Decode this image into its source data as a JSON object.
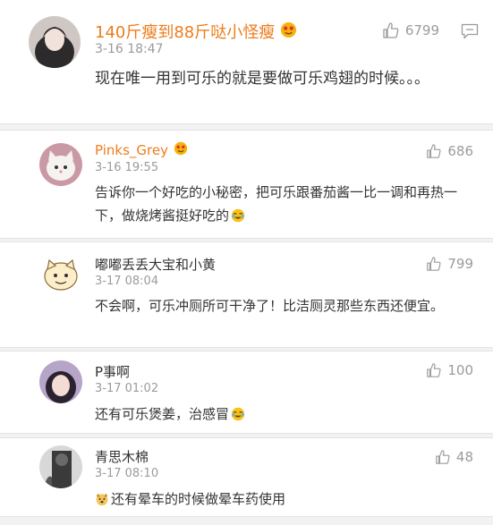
{
  "comments": [
    {
      "name": "140斤瘦到88斤哒小怪瘦",
      "time": "3-16 18:47",
      "text": "现在唯一用到可乐的就是要做可乐鸡翅的时候。。。",
      "likes": "6799",
      "badge": "vip-face-icon",
      "name_color": "#ec7d1c"
    },
    {
      "name": "Pinks_Grey",
      "time": "3-16 19:55",
      "text": "告诉你一个好吃的小秘密，把可乐跟番茄酱一比一调和再热一下，做烧烤酱挺好吃的",
      "likes": "686",
      "badge": "vip-face-icon",
      "name_color": "#ec7d1c",
      "trailing_emoji": "laugh-cry-emoji"
    },
    {
      "name": "嘟嘟丢丢大宝和小黄",
      "time": "3-17 08:04",
      "text": "不会啊，可乐冲厕所可干净了！比洁厕灵那些东西还便宜。",
      "likes": "799"
    },
    {
      "name": "P事啊",
      "time": "3-17 01:02",
      "text": "还有可乐煲姜，治感冒",
      "likes": "100",
      "trailing_emoji": "laugh-cry-emoji"
    },
    {
      "name": "青思木棉",
      "time": "3-17 08:10",
      "text": "还有晕车的时候做晕车药使用",
      "likes": "48",
      "leading_emoji": "dog-face-emoji"
    }
  ],
  "colors": {
    "vip_name": "#ec7d1c",
    "normal_name": "#333333",
    "meta": "#9b9b9b",
    "background": "#f2f2f2"
  }
}
